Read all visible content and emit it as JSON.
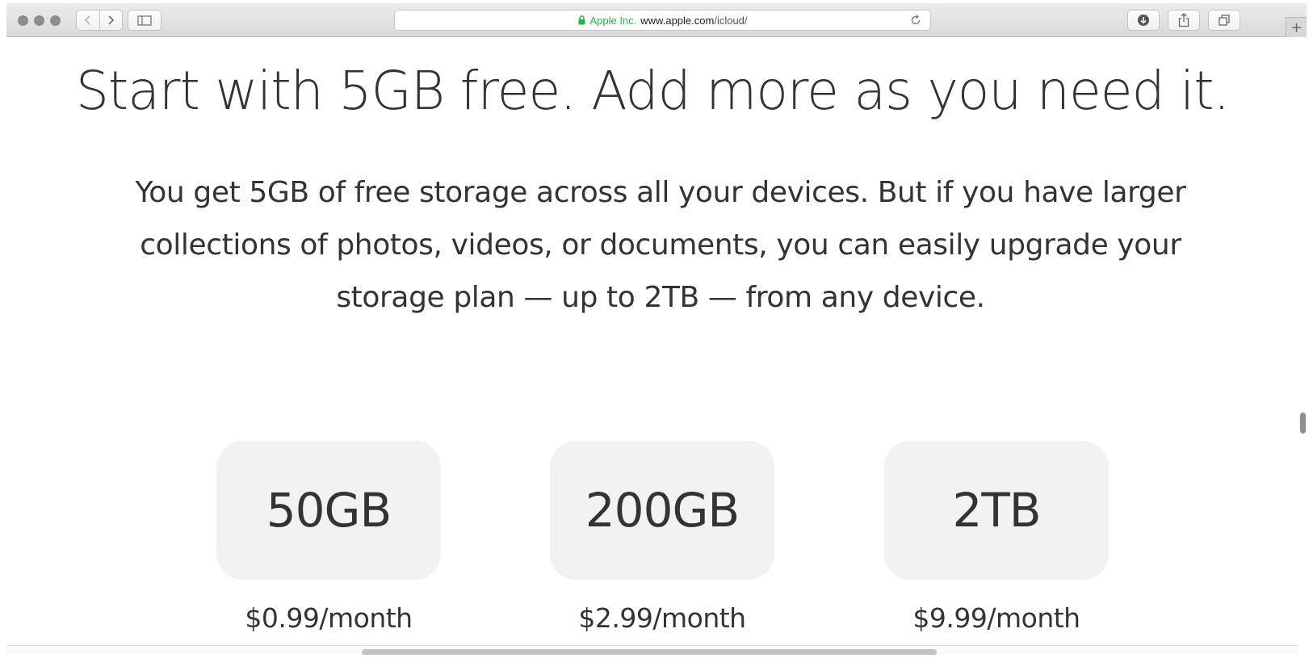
{
  "browser": {
    "address_org": "Apple Inc.",
    "address_host": "www.apple.com",
    "address_path": "/icloud/",
    "new_tab_label": "+"
  },
  "page": {
    "headline": "Start with 5GB free. Add more as you need it.",
    "intro": "You get 5GB of free storage across all your devices. But if you have larger collections of photos, videos, or documents, you can easily upgrade your storage plan — up to 2TB — from any device.",
    "plans": [
      {
        "size": "50GB",
        "price": "$0.99/month"
      },
      {
        "size": "200GB",
        "price": "$2.99/month"
      },
      {
        "size": "2TB",
        "price": "$9.99/month"
      }
    ]
  },
  "colors": {
    "text": "#333333",
    "tile_bg": "#f2f2f2",
    "secure_green": "#2bb14a"
  }
}
